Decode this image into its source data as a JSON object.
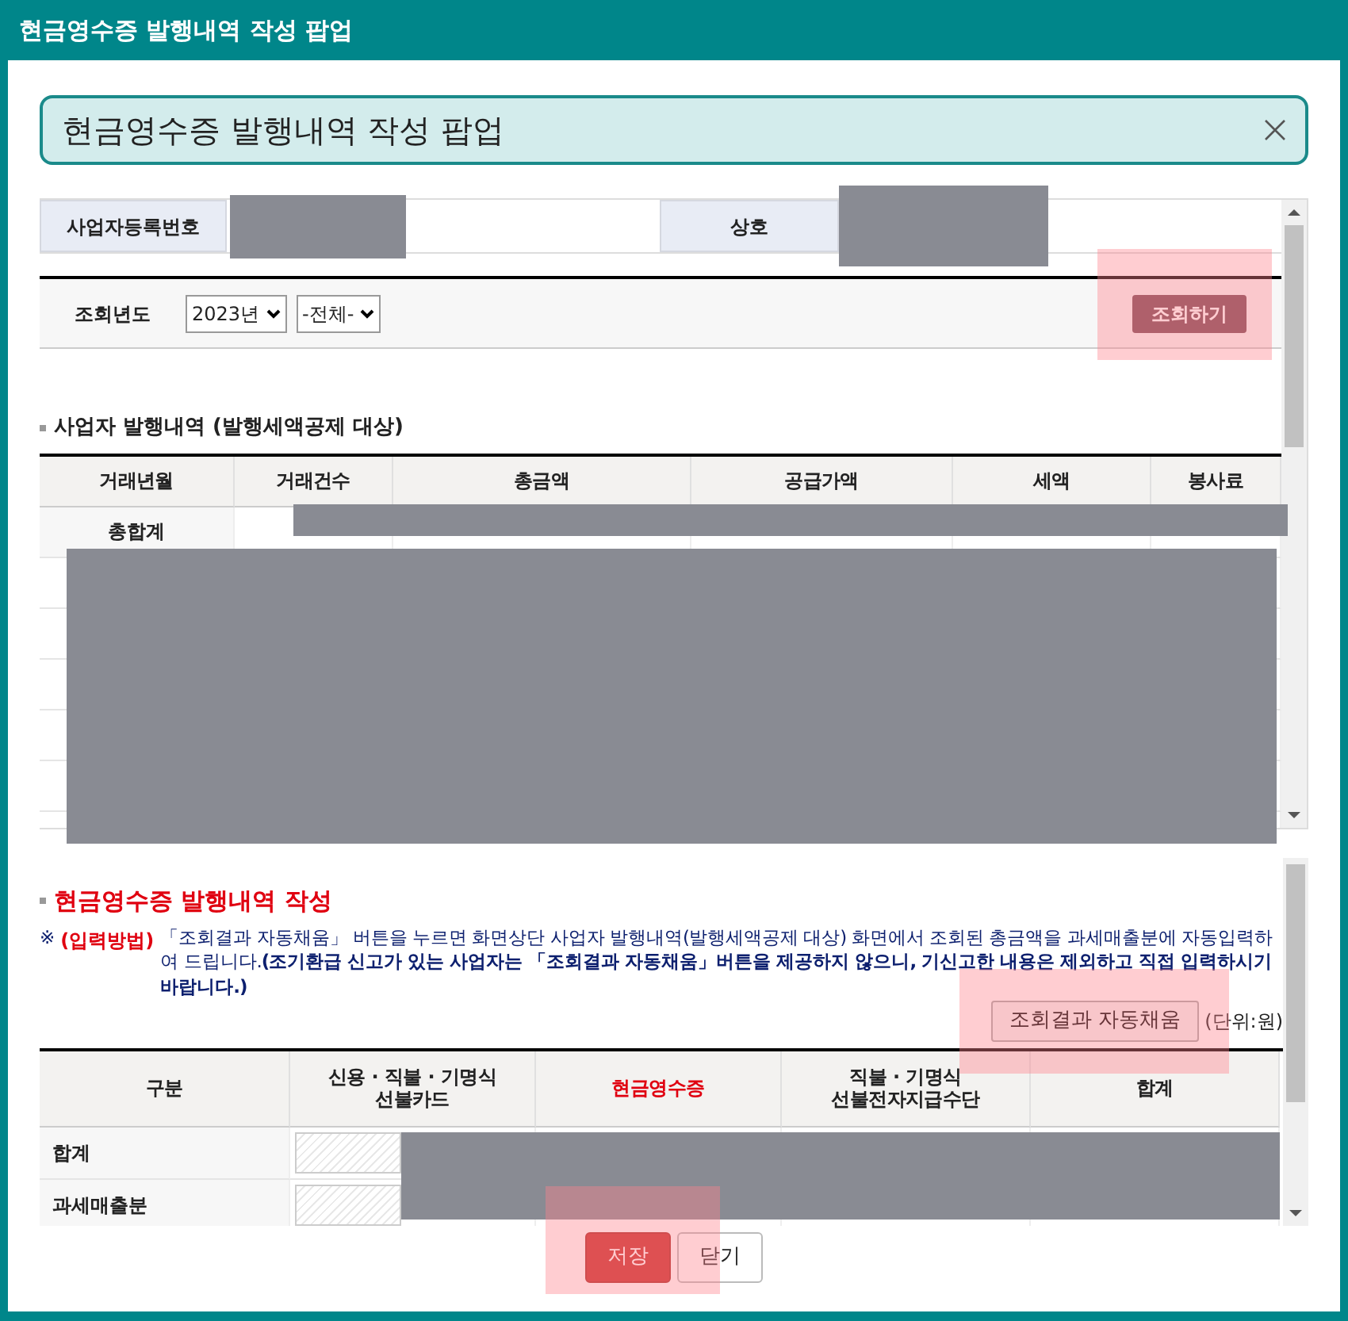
{
  "window": {
    "title": "현금영수증 발행내역 작성 팝업"
  },
  "header_alert": {
    "title": "현금영수증 발행내역 작성 팝업"
  },
  "business_info": [
    {
      "label": "사업자등록번호"
    },
    {
      "label": "상호"
    }
  ],
  "search": {
    "label": "조회년도",
    "year": "2023년",
    "period": "-전체-",
    "button": "조회하기"
  },
  "issuance_section": {
    "title": "사업자 발행내역 (발행세액공제 대상)",
    "columns": [
      "거래년월",
      "거래건수",
      "총금액",
      "공급가액",
      "세액",
      "봉사료"
    ],
    "rows": [
      {
        "label": "총합계"
      }
    ]
  },
  "write_section": {
    "title": "현금영수증 발행내역 작성",
    "note_mark": "※",
    "note_label": "(입력방법)",
    "note_text": "「조회결과 자동채움」 버튼을 누르면 화면상단 사업자 발행내역(발행세액공제 대상) 화면에서 조회된 총금액을 과세매출분에 자동입력하여 드립니다.**(조기환급 신고가 있는 사업자는 「조회결과 자동채움」버튼을 제공하지 않으니, 기신고한 내용은 제외하고 직접 입력하시기 바랍니다.)**",
    "autofill_button": "조회결과 자동채움",
    "unit": "(단위:원)",
    "columns": [
      {
        "label": "구분",
        "highlight": false
      },
      {
        "label": "신용 · 직불 · 기명식\n선불카드",
        "highlight": false
      },
      {
        "label": "현금영수증",
        "highlight": true
      },
      {
        "label": "직불 · 기명식\n선불전자지급수단",
        "highlight": false
      },
      {
        "label": "합계",
        "highlight": false
      }
    ],
    "rows": [
      {
        "label": "합계"
      },
      {
        "label": "과세매출분"
      }
    ]
  },
  "buttons": [
    {
      "label": "저장",
      "kind": "primary"
    },
    {
      "label": "닫기",
      "kind": "secondary"
    }
  ]
}
